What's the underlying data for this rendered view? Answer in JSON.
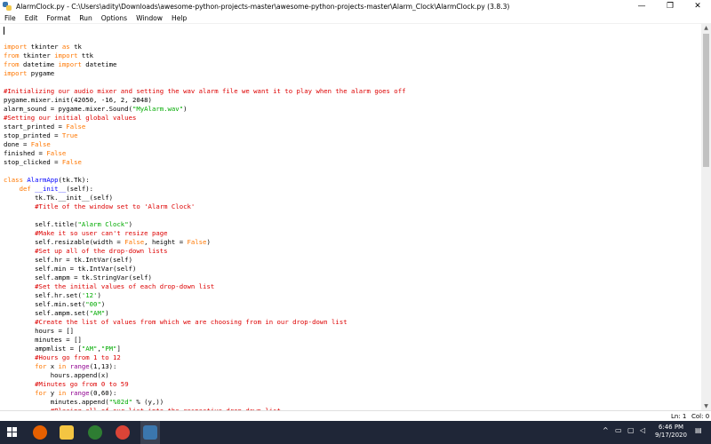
{
  "window": {
    "title": "AlarmClock.py - C:\\Users\\adity\\Downloads\\awesome-python-projects-master\\awesome-python-projects-master\\Alarm_Clock\\AlarmClock.py (3.8.3)",
    "controls": {
      "minimize": "—",
      "maximize": "❐",
      "close": "✕"
    }
  },
  "menu": [
    "File",
    "Edit",
    "Format",
    "Run",
    "Options",
    "Window",
    "Help"
  ],
  "status": {
    "line": "Ln: 1",
    "col": "Col: 0"
  },
  "taskbar": {
    "time": "6:46 PM",
    "date": "9/17/2020"
  },
  "code_lines": [
    [
      [
        "kw",
        "import"
      ],
      [
        "",
        " tkinter "
      ],
      [
        "kw",
        "as"
      ],
      [
        "",
        " tk"
      ]
    ],
    [
      [
        "kw",
        "from"
      ],
      [
        "",
        " tkinter "
      ],
      [
        "kw",
        "import"
      ],
      [
        "",
        " ttk"
      ]
    ],
    [
      [
        "kw",
        "from"
      ],
      [
        "",
        " datetime "
      ],
      [
        "kw",
        "import"
      ],
      [
        "",
        " datetime"
      ]
    ],
    [
      [
        "kw",
        "import"
      ],
      [
        "",
        " pygame"
      ]
    ],
    [],
    [
      [
        "cm",
        "#Initializing our audio mixer and setting the wav alarm file we want it to play when the alarm goes off"
      ]
    ],
    [
      [
        "",
        "pygame.mixer.init(42050, -16, 2, 2048)"
      ]
    ],
    [
      [
        "",
        "alarm_sound = pygame.mixer.Sound("
      ],
      [
        "str",
        "\"MyAlarm.wav\""
      ],
      [
        "",
        ")"
      ]
    ],
    [
      [
        "cm",
        "#Setting our initial global values"
      ]
    ],
    [
      [
        "",
        "start_printed = "
      ],
      [
        "kw",
        "False"
      ]
    ],
    [
      [
        "",
        "stop_printed = "
      ],
      [
        "kw",
        "True"
      ]
    ],
    [
      [
        "",
        "done = "
      ],
      [
        "kw",
        "False"
      ]
    ],
    [
      [
        "",
        "finished = "
      ],
      [
        "kw",
        "False"
      ]
    ],
    [
      [
        "",
        "stop_clicked = "
      ],
      [
        "kw",
        "False"
      ]
    ],
    [],
    [
      [
        "kw",
        "class"
      ],
      [
        "",
        " "
      ],
      [
        "def",
        "AlarmApp"
      ],
      [
        "",
        "(tk.Tk):"
      ]
    ],
    [
      [
        "",
        "    "
      ],
      [
        "kw",
        "def"
      ],
      [
        "",
        " "
      ],
      [
        "def",
        "__init__"
      ],
      [
        "",
        "(self):"
      ]
    ],
    [
      [
        "",
        "        tk.Tk.__init__(self)"
      ]
    ],
    [
      [
        "",
        "        "
      ],
      [
        "cm",
        "#Title of the window set to 'Alarm Clock'"
      ]
    ],
    [],
    [
      [
        "",
        "        self.title("
      ],
      [
        "str",
        "\"Alarm Clock\""
      ],
      [
        "",
        ")"
      ]
    ],
    [
      [
        "",
        "        "
      ],
      [
        "cm",
        "#Make it so user can't resize page"
      ]
    ],
    [
      [
        "",
        "        self.resizable(width = "
      ],
      [
        "kw",
        "False"
      ],
      [
        "",
        ", height = "
      ],
      [
        "kw",
        "False"
      ],
      [
        "",
        ")"
      ]
    ],
    [
      [
        "",
        "        "
      ],
      [
        "cm",
        "#Set up all of the drop-down lists"
      ]
    ],
    [
      [
        "",
        "        self.hr = tk.IntVar(self)"
      ]
    ],
    [
      [
        "",
        "        self.min = tk.IntVar(self)"
      ]
    ],
    [
      [
        "",
        "        self.ampm = tk.StringVar(self)"
      ]
    ],
    [
      [
        "",
        "        "
      ],
      [
        "cm",
        "#Set the initial values of each drop-down list"
      ]
    ],
    [
      [
        "",
        "        self.hr.set("
      ],
      [
        "str",
        "'12'"
      ],
      [
        "",
        ")"
      ]
    ],
    [
      [
        "",
        "        self.min.set("
      ],
      [
        "str",
        "\"00\""
      ],
      [
        "",
        ")"
      ]
    ],
    [
      [
        "",
        "        self.ampm.set("
      ],
      [
        "str",
        "\"AM\""
      ],
      [
        "",
        ")"
      ]
    ],
    [
      [
        "",
        "        "
      ],
      [
        "cm",
        "#Create the list of values from which we are choosing from in our drop-down list"
      ]
    ],
    [
      [
        "",
        "        hours = []"
      ]
    ],
    [
      [
        "",
        "        minutes = []"
      ]
    ],
    [
      [
        "",
        "        ampmlist = ["
      ],
      [
        "str",
        "\"AM\""
      ],
      [
        "",
        ","
      ],
      [
        "str",
        "\"PM\""
      ],
      [
        "",
        "]"
      ]
    ],
    [
      [
        "",
        "        "
      ],
      [
        "cm",
        "#Hours go from 1 to 12"
      ]
    ],
    [
      [
        "",
        "        "
      ],
      [
        "kw",
        "for"
      ],
      [
        "",
        " x "
      ],
      [
        "kw",
        "in"
      ],
      [
        "",
        " "
      ],
      [
        "bi",
        "range"
      ],
      [
        "",
        "(1,13):"
      ]
    ],
    [
      [
        "",
        "            hours.append(x)"
      ]
    ],
    [
      [
        "",
        "        "
      ],
      [
        "cm",
        "#Minutes go from 0 to 59"
      ]
    ],
    [
      [
        "",
        "        "
      ],
      [
        "kw",
        "for"
      ],
      [
        "",
        " y "
      ],
      [
        "kw",
        "in"
      ],
      [
        "",
        " "
      ],
      [
        "bi",
        "range"
      ],
      [
        "",
        "(0,60):"
      ]
    ],
    [
      [
        "",
        "            minutes.append("
      ],
      [
        "str",
        "\"%02d\""
      ],
      [
        "",
        " % (y,))"
      ]
    ],
    [
      [
        "",
        "            "
      ],
      [
        "cm",
        "#Placing all of our list into the respective drop-down list"
      ]
    ]
  ]
}
